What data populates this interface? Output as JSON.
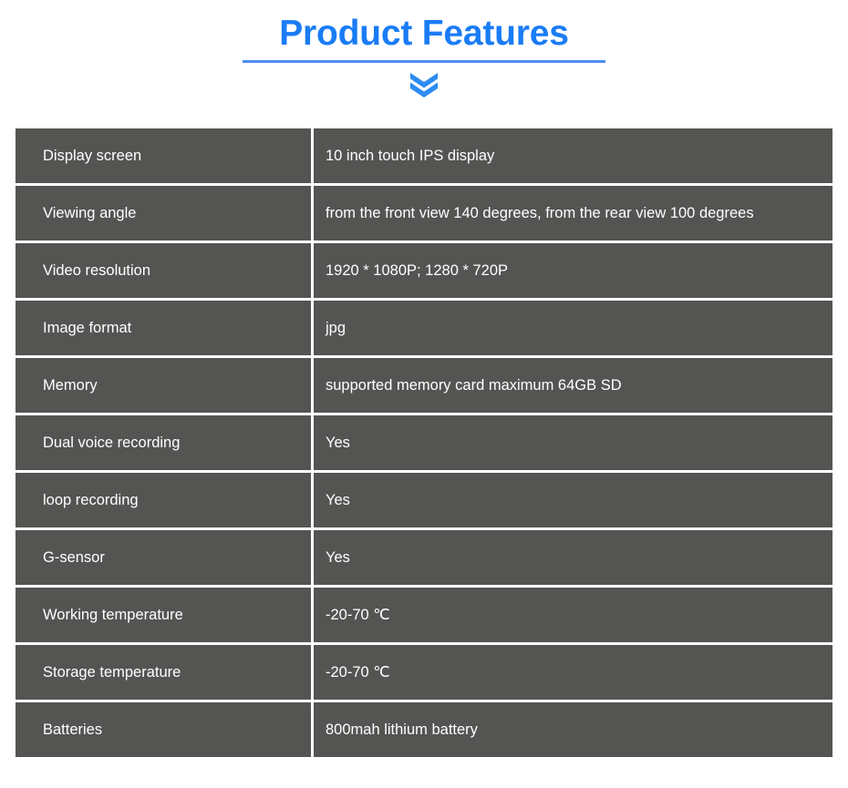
{
  "header": {
    "title": "Product Features",
    "divider_color": "#4d8ef2",
    "title_color": "#1a7cf5",
    "chevron_icon": "double-chevron-down-icon",
    "chevron_color": "#2d8cf0"
  },
  "table": {
    "background_color": "#545452",
    "text_color": "#ffffff",
    "rows": [
      {
        "label": "Display screen",
        "value": "10 inch touch IPS display"
      },
      {
        "label": "Viewing angle",
        "value": "from the front view 140 degrees, from the rear view 100 degrees"
      },
      {
        "label": "Video resolution",
        "value": "1920 * 1080P; 1280 * 720P"
      },
      {
        "label": "Image format",
        "value": "jpg"
      },
      {
        "label": "Memory",
        "value": "supported memory card maximum 64GB SD"
      },
      {
        "label": "Dual voice recording",
        "value": "Yes"
      },
      {
        "label": "loop recording",
        "value": "Yes"
      },
      {
        "label": "G-sensor",
        "value": "Yes"
      },
      {
        "label": "Working temperature",
        "value": "-20-70 ℃"
      },
      {
        "label": "Storage temperature",
        "value": "-20-70 ℃"
      },
      {
        "label": "Batteries",
        "value": "800mah lithium battery"
      }
    ]
  }
}
